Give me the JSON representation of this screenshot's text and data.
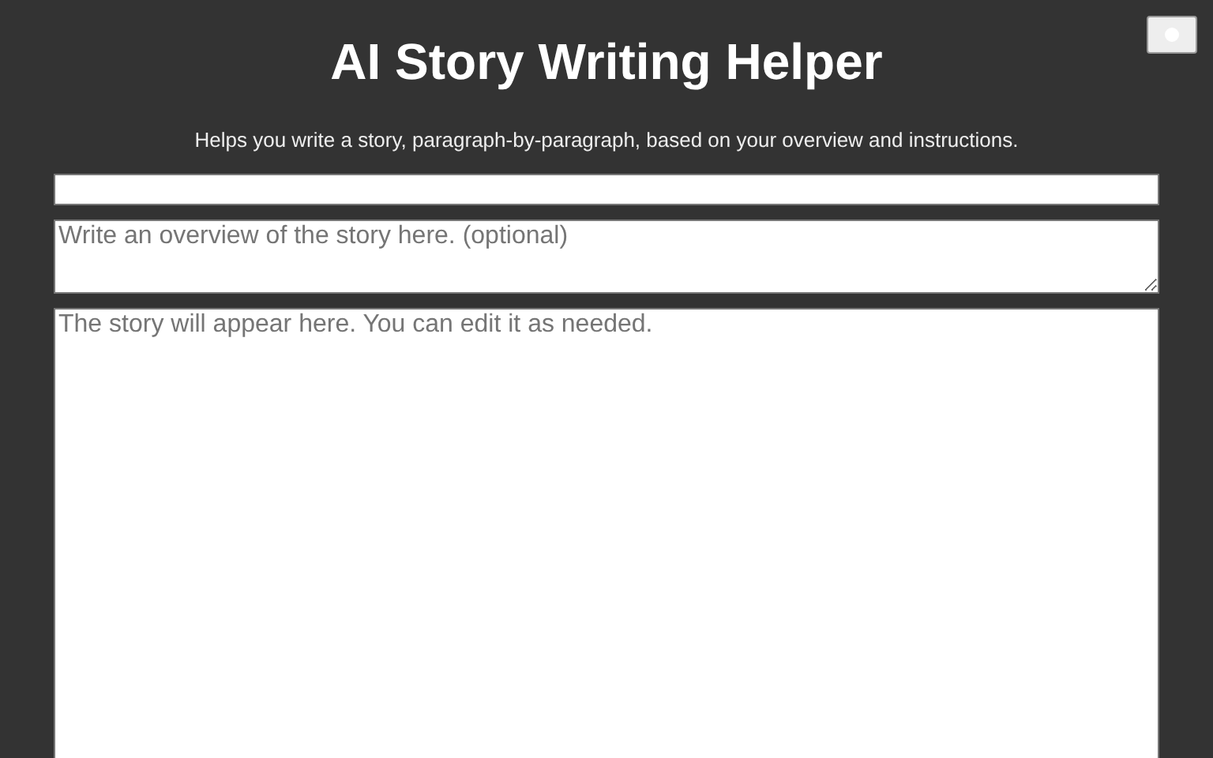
{
  "header": {
    "title": "AI Story Writing Helper",
    "subtitle": "Helps you write a story, paragraph-by-paragraph, based on your overview and instructions."
  },
  "theme_toggle": {
    "kind": "sun"
  },
  "fields": [
    {
      "kind": "input"
    },
    {
      "kind": "textarea",
      "placeholder": "Write an overview of the story here. (optional)"
    },
    {
      "kind": "story",
      "placeholder": "The story will appear here. You can edit it as needed."
    }
  ]
}
